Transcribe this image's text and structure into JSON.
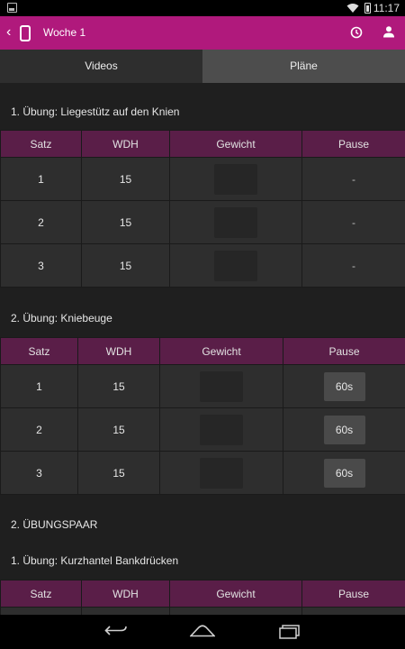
{
  "status_bar": {
    "time": "11:17"
  },
  "action_bar": {
    "title": "Woche 1"
  },
  "tabs": [
    {
      "label": "Videos",
      "active": true
    },
    {
      "label": "Pläne",
      "active": false
    }
  ],
  "section_pair_label": "2. ÜBUNGSPAAR",
  "exercises": [
    {
      "title": "1. Übung: Liegestütz auf den Knien",
      "headers": [
        "Satz",
        "WDH",
        "Gewicht",
        "Pause"
      ],
      "rows": [
        {
          "satz": "1",
          "wdh": "15",
          "pause": "-"
        },
        {
          "satz": "2",
          "wdh": "15",
          "pause": "-"
        },
        {
          "satz": "3",
          "wdh": "15",
          "pause": "-"
        }
      ]
    },
    {
      "title": "2. Übung: Kniebeuge",
      "headers": [
        "Satz",
        "WDH",
        "Gewicht",
        "Pause"
      ],
      "rows": [
        {
          "satz": "1",
          "wdh": "15",
          "pause": "60s"
        },
        {
          "satz": "2",
          "wdh": "15",
          "pause": "60s"
        },
        {
          "satz": "3",
          "wdh": "15",
          "pause": "60s"
        }
      ]
    },
    {
      "title": "1. Übung: Kurzhantel Bankdrücken",
      "headers": [
        "Satz",
        "WDH",
        "Gewicht",
        "Pause"
      ],
      "rows": []
    }
  ],
  "colors": {
    "action_bar": "#b0197c",
    "table_header": "#5a1e48",
    "cell_bg": "#2e2e2e",
    "pause_button": "#4a4a4a"
  },
  "icons": {
    "status_left": "image-notification-icon",
    "wifi": "wifi-icon",
    "battery": "battery-icon",
    "back": "back-arrow-icon",
    "app_logo": "app-logo-icon",
    "history": "clock-icon",
    "profile": "user-icon",
    "nav_back": "nav-back-icon",
    "nav_home": "nav-home-icon",
    "nav_recents": "nav-recents-icon"
  }
}
